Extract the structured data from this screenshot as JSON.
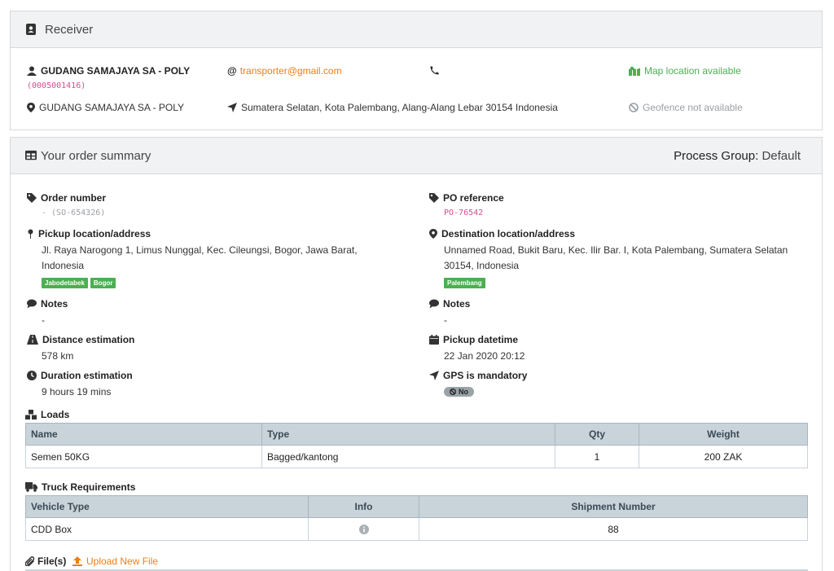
{
  "receiver": {
    "title": "Receiver",
    "name": "GUDANG SAMAJAYA SA - POLY",
    "code": "(0005001416)",
    "email": "transporter@gmail.com",
    "location_name": "GUDANG SAMAJAYA SA - POLY",
    "address": "Sumatera Selatan, Kota Palembang, Alang-Alang Lebar 30154 Indonesia",
    "map_status": "Map location available",
    "geofence_status": "Geofence not available"
  },
  "summary": {
    "title": "Your order summary",
    "process_group_label": "Process Group:",
    "process_group_value": "Default",
    "order_number_label": "Order number",
    "order_number_value": "- (SO-654326)",
    "po_label": "PO reference",
    "po_value": "PO-76542",
    "pickup_label": "Pickup location/address",
    "pickup_line1": "Jl. Raya Narogong 1, Limus Nunggal, Kec. Cileungsi, Bogor, Jawa Barat,",
    "pickup_line2": "Indonesia",
    "pickup_tags": [
      "Jabodetabek",
      "Bogor"
    ],
    "dest_label": "Destination location/address",
    "dest_line1": "Unnamed Road, Bukit Baru, Kec. Ilir Bar. I, Kota Palembang, Sumatera Selatan",
    "dest_line2": "30154, Indonesia",
    "dest_tags": [
      "Palembang"
    ],
    "notes_label": "Notes",
    "notes_left": "-",
    "notes_right": "-",
    "distance_label": "Distance estimation",
    "distance_value": "578 km",
    "pickup_dt_label": "Pickup datetime",
    "pickup_dt_value": "22 Jan 2020 20:12",
    "duration_label": "Duration estimation",
    "duration_value": "9 hours 19 mins",
    "gps_label": "GPS is mandatory",
    "gps_value": "No"
  },
  "loads": {
    "title": "Loads",
    "headers": [
      "Name",
      "Type",
      "Qty",
      "Weight"
    ],
    "rows": [
      [
        "Semen 50KG",
        "Bagged/kantong",
        "1",
        "200 ZAK"
      ]
    ]
  },
  "truck": {
    "title": "Truck Requirements",
    "headers": [
      "Vehicle Type",
      "Info",
      "Shipment Number"
    ],
    "rows": [
      [
        "CDD Box",
        "",
        "88"
      ]
    ]
  },
  "files": {
    "title": "File(s)",
    "upload_label": "Upload New File"
  },
  "colors": {
    "accent_orange": "#f07d16",
    "green": "#4caf50",
    "pink": "#d64d8f",
    "muted": "#9aa0a6"
  }
}
